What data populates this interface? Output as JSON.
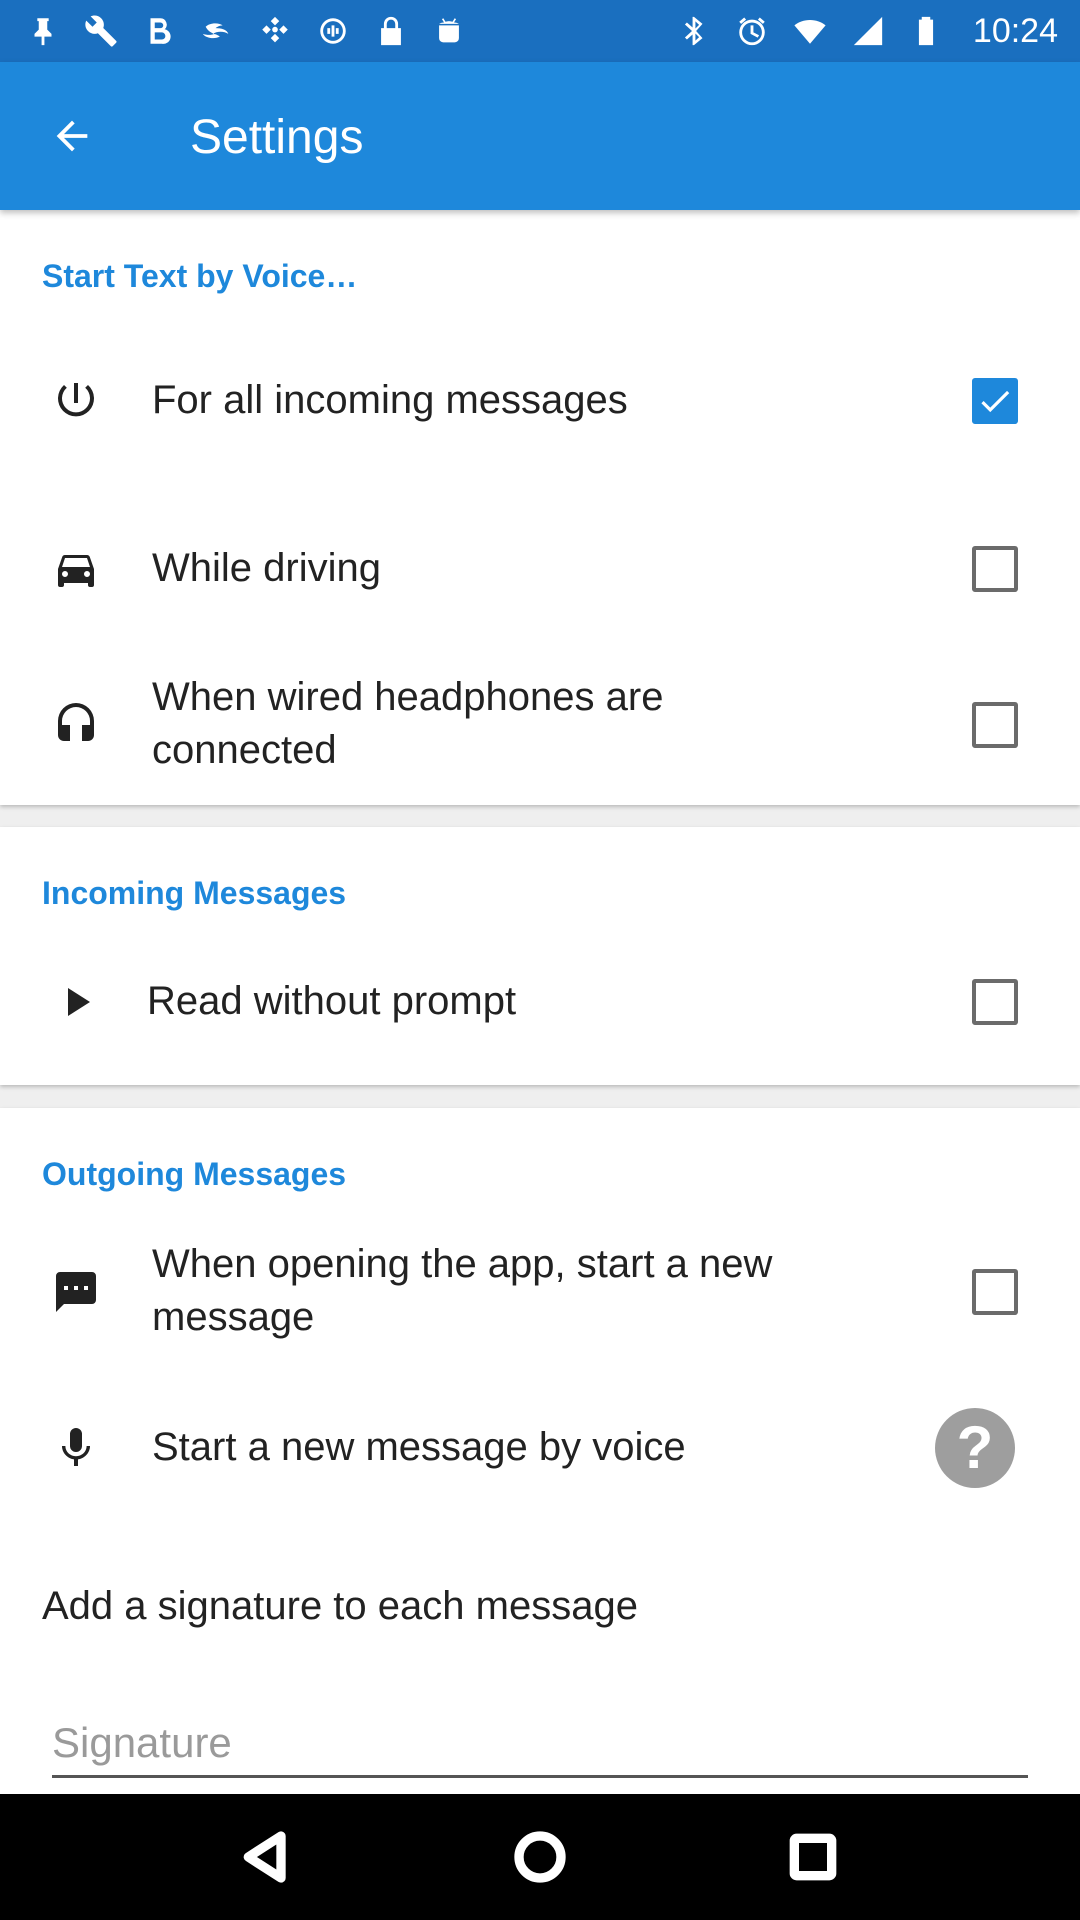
{
  "status_bar": {
    "time": "10:24",
    "left_icons": [
      "pin-icon",
      "wrench-icon",
      "bold-icon",
      "swift-icon",
      "fake-gps-icon",
      "sync-icon",
      "lock-icon",
      "android-icon"
    ],
    "right_icons": [
      "bluetooth-icon",
      "alarm-icon",
      "wifi-icon",
      "signal-icon",
      "battery-icon"
    ]
  },
  "app_bar": {
    "title": "Settings",
    "back_icon": "arrow-back-icon"
  },
  "sections": {
    "voice": {
      "header": "Start Text by Voice…",
      "items": [
        {
          "label": "For all incoming messages",
          "icon": "power-icon",
          "checked": true
        },
        {
          "label": "While driving",
          "icon": "car-icon",
          "checked": false
        },
        {
          "label": "When wired headphones are connected",
          "icon": "headphones-icon",
          "checked": false
        }
      ]
    },
    "incoming": {
      "header": "Incoming Messages",
      "items": [
        {
          "label": "Read without prompt",
          "icon": "play-icon",
          "checked": false
        }
      ]
    },
    "outgoing": {
      "header": "Outgoing Messages",
      "items": [
        {
          "label": "When opening the app, start a new message",
          "icon": "chat-icon",
          "checked": false
        },
        {
          "label": "Start a new message by voice",
          "icon": "mic-icon",
          "help": "?"
        }
      ],
      "signature_label": "Add a signature to each message",
      "signature_placeholder": "Signature",
      "signature_value": ""
    }
  },
  "colors": {
    "status_bar": "#1a6fbf",
    "app_bar": "#1e88db",
    "accent": "#1e88db",
    "help_button": "#9e9e9e"
  },
  "nav_bar": {
    "buttons": [
      "back-triangle-icon",
      "home-circle-icon",
      "recents-square-icon"
    ]
  }
}
